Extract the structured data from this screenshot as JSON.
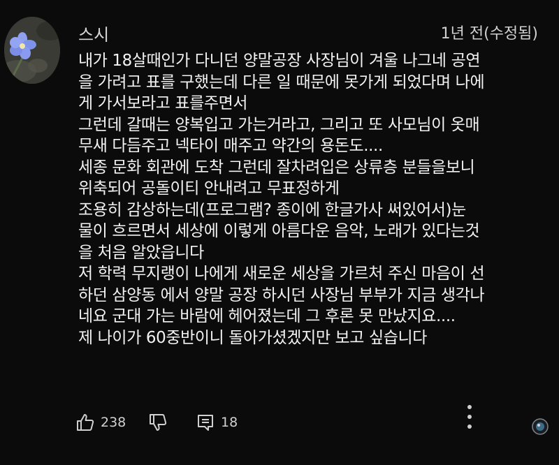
{
  "comment": {
    "author": "스시",
    "timestamp": "1년 전(수정됨)",
    "lines": [
      "내가 18살때인가 다니던 양말공장 사장님이 겨울 나그네 공연",
      "을 가려고 표를 구했는데 다른 일 때문에 못가게 되었다며 나에",
      "게 가서보라고 표를주면서",
      "그런데 갈때는 양복입고 가는거라고, 그리고 또 사모님이 옷매",
      "무새 다듬주고 넥타이 매주고 약간의 용돈도....",
      "세종 문화 회관에 도착 그런데 잘차려입은 상류층 분들을보니",
      "위축되어  공돌이티 안내려고 무표정하게",
      " 조용히 감상하는데(프로그램? 종이에 한글가사 써있어서)눈",
      "물이 흐르면서 세상에 이렇게 아름다운 음악, 노래가 있다는것",
      "을 처음 알았읍니다",
      "저 학력 무지랭이 나에게 새로운 세상을 가르처 주신 마음이 선",
      "하던 삼양동 에서 양말 공장 하시던 사장님 부부가 지금 생각나",
      "네요 군대 가는 바람에 헤어졌는데 그 후론 못 만났지요....",
      "제 나이가 60중반이니 돌아가셨겠지만 보고 싶습니다"
    ],
    "like_count": "238",
    "reply_count": "18"
  },
  "icons": {
    "like": "thumbs-up-icon",
    "dislike": "thumbs-down-icon",
    "reply": "reply-icon",
    "more": "more-vertical-icon",
    "sponsor": "sponsor-icon"
  },
  "colors": {
    "background": "#0b0b0b",
    "text": "#f2f2f2",
    "secondary": "#d0d0d0"
  }
}
